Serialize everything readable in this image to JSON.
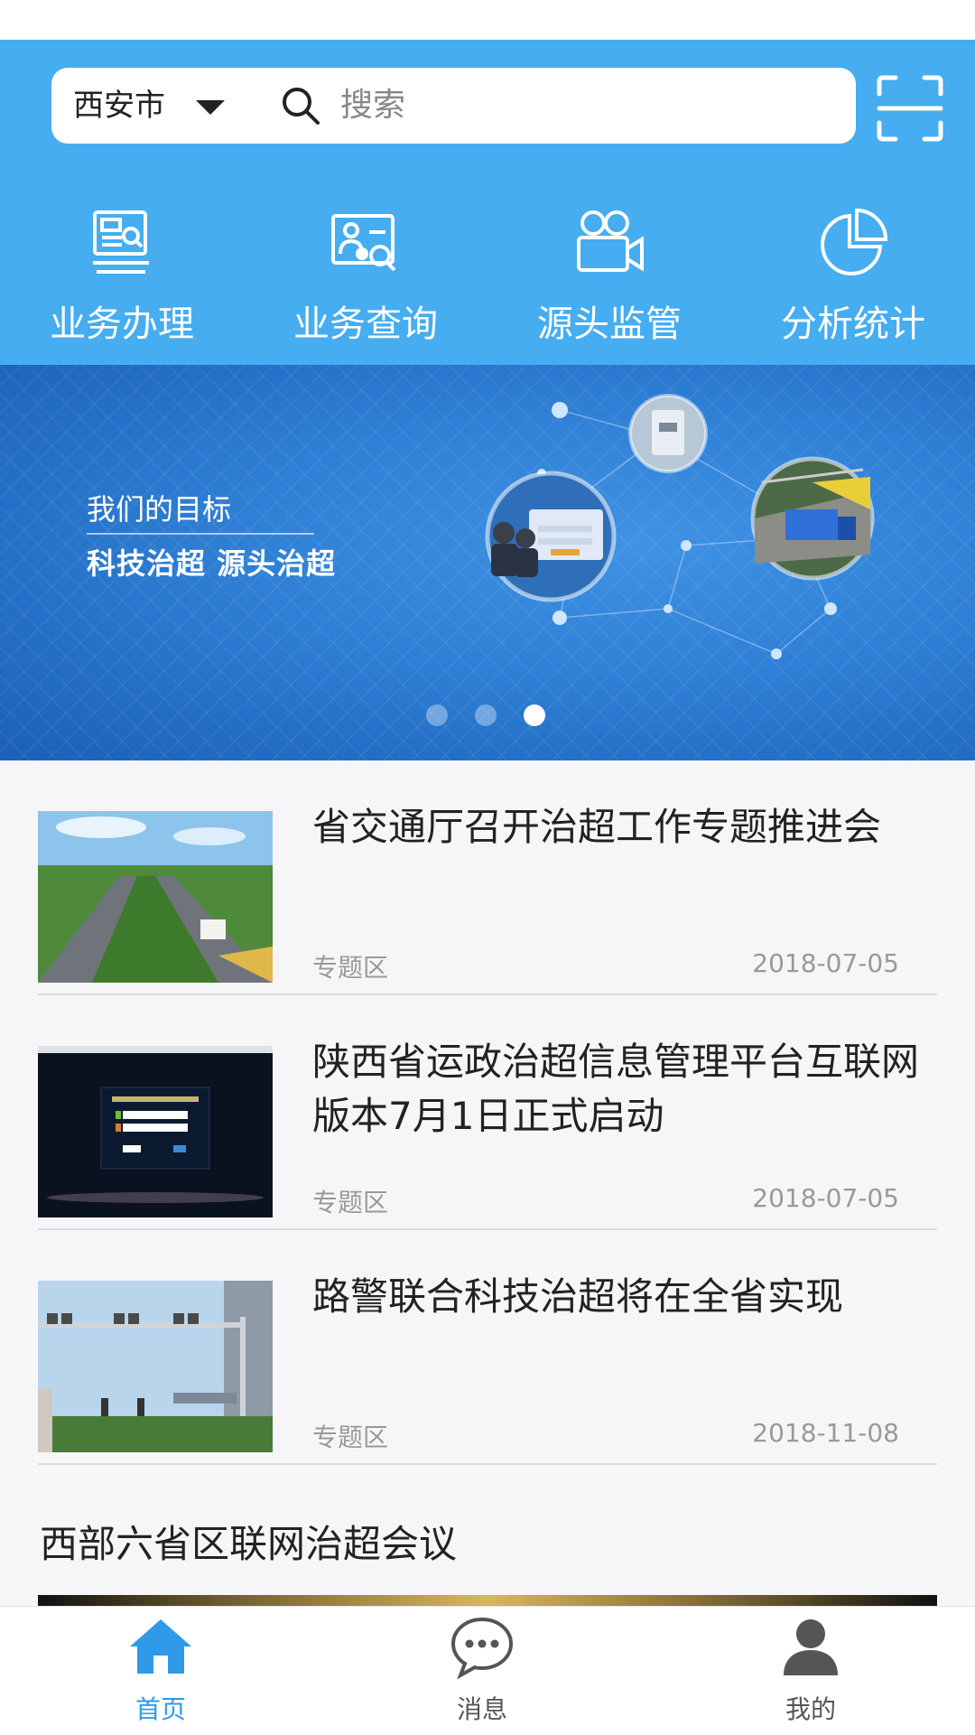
{
  "header": {
    "city": "西安市",
    "search_placeholder": "搜索",
    "quick_nav": [
      {
        "label": "业务办理",
        "icon": "business-handling-icon"
      },
      {
        "label": "业务查询",
        "icon": "business-query-icon"
      },
      {
        "label": "源头监管",
        "icon": "camera-icon"
      },
      {
        "label": "分析统计",
        "icon": "pie-chart-icon"
      }
    ]
  },
  "banner": {
    "heading": "我们的目标",
    "slogan": "科技治超  源头治超",
    "dots_count": 3,
    "active_dot": 3
  },
  "news": [
    {
      "title": "省交通厅召开治超工作专题推进会",
      "tag": "专题区",
      "date": "2018-07-05"
    },
    {
      "title": "陕西省运政治超信息管理平台互联网版本7月1日正式启动",
      "tag": "专题区",
      "date": "2018-07-05"
    },
    {
      "title": "路警联合科技治超将在全省实现",
      "tag": "专题区",
      "date": "2018-11-08"
    }
  ],
  "section": {
    "title": "西部六省区联网治超会议"
  },
  "tabbar": {
    "tabs": [
      {
        "label": "首页",
        "icon": "home-icon",
        "active": true
      },
      {
        "label": "消息",
        "icon": "message-icon",
        "active": false
      },
      {
        "label": "我的",
        "icon": "user-icon",
        "active": false
      }
    ]
  },
  "colors": {
    "header_blue": "#45adf0",
    "active_tab": "#2f9ae8",
    "banner_blue": "#2e7fd5"
  }
}
